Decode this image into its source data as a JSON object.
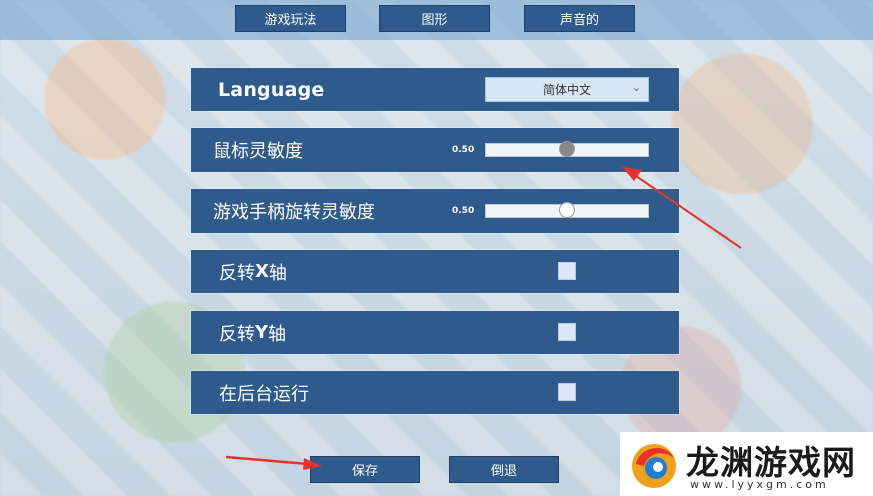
{
  "tabs": [
    {
      "label": "游戏玩法"
    },
    {
      "label": "图形"
    },
    {
      "label": "声音的"
    }
  ],
  "settings": {
    "language": {
      "label": "Language",
      "selected": "简体中文",
      "chevron": "⌄"
    },
    "mouse_sensitivity": {
      "label": "鼠标灵敏度",
      "value_text": "0.50",
      "value": 0.5
    },
    "gamepad_sensitivity": {
      "label": "游戏手柄旋转灵敏度",
      "value_text": "0.50",
      "value": 0.5
    },
    "invert_x": {
      "label_pre": "反转",
      "label_axis": "X",
      "label_post": "轴",
      "checked": false
    },
    "invert_y": {
      "label_pre": "反转",
      "label_axis": "Y",
      "label_post": "轴",
      "checked": false
    },
    "run_in_background": {
      "label": "在后台运行",
      "checked": false
    }
  },
  "buttons": {
    "save": "保存",
    "revert": "倒退"
  },
  "watermark": {
    "text": "龙渊游戏网",
    "url": "www.lyyxgm.com"
  },
  "colors": {
    "panel": "#2f5b8c",
    "arrow": "#e8332a",
    "accent": "#d7e6f5"
  }
}
